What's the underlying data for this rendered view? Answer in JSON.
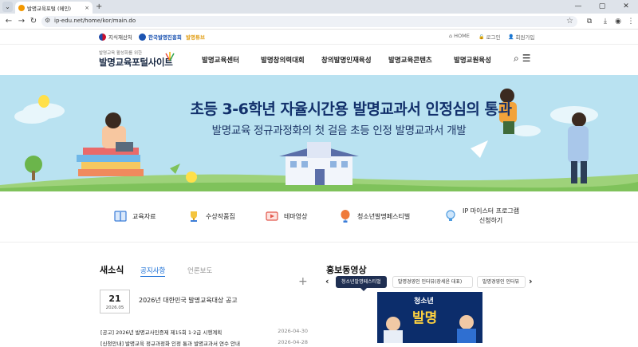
{
  "browser": {
    "tab_title": "발명교육포털 (메인)",
    "tab_close": "×",
    "new_tab": "+",
    "url": "ip-edu.net/home/kor/main.do",
    "window": {
      "minimize": "—",
      "maximize": "▢",
      "close": "✕"
    }
  },
  "topstrip": {
    "logos": [
      {
        "label": "지식재산처",
        "color": "#1f4aa8"
      },
      {
        "label": "한국발명진흥회",
        "color": "#1c54b2"
      },
      {
        "label": "발명튜브",
        "color": "#e2a01a"
      }
    ],
    "util": [
      {
        "icon": "home-icon",
        "glyph": "⌂",
        "label": "HOME"
      },
      {
        "icon": "lock-icon",
        "glyph": "🔒",
        "label": "로그인"
      },
      {
        "icon": "user-icon",
        "glyph": "👤",
        "label": "회원가입"
      }
    ]
  },
  "header": {
    "logo_tag": "발명교육 활성화를 위한",
    "logo_name": "발명교육포털사이트",
    "menu": [
      "발명교육센터",
      "발명창의력대회",
      "창의발명인재육성",
      "발명교육콘텐츠",
      "발명교원육성"
    ],
    "search_glyph": "⌕",
    "menu_glyph": "☰"
  },
  "banner": {
    "title": "초등 3-6학년 자율시간용 발명교과서 인정심의 통과",
    "subtitle": "발명교육 정규과정화의 첫 걸음 초등 인정 발명교과서 개발"
  },
  "quick_menu": [
    {
      "label": "교육자료",
      "icon": "book-icon",
      "color": "#3b7dd8"
    },
    {
      "label": "수상작품집",
      "icon": "trophy-icon",
      "color": "#e0a21c"
    },
    {
      "label": "테마영상",
      "icon": "video-icon",
      "color": "#e2574c"
    },
    {
      "label": "청소년발명페스티벌",
      "icon": "balloon-icon",
      "color": "#ef7a3b"
    },
    {
      "label_1": "IP 마이스터 프로그램",
      "label_2": "신청하기",
      "icon": "lightbulb-icon",
      "color": "#4c9be0"
    }
  ],
  "news": {
    "title": "새소식",
    "tabs": [
      "공지사항",
      "언론보도"
    ],
    "more": "+",
    "featured": {
      "day": "21",
      "month": "2026.05",
      "title": "2026년 대한민국 발명교육대상 공고"
    },
    "rows": [
      {
        "title": "[공고] 2026년 발명교사인증제 제15회 1·2급 시행계획",
        "date": "2026-04-30"
      },
      {
        "title": "[신청안내] 발명교육 정규과정화 인정 통과 발명교과서 연수 안내",
        "date": "2026-04-28"
      }
    ]
  },
  "promo": {
    "title": "홍보동영상",
    "prev": "‹",
    "next": "›",
    "tabs": [
      "청소년발명페스티벌",
      "발명경영인 인터뷰(장세윤 대표)",
      "발명경영인 인터뷰"
    ],
    "thumb_caption_1": "청소년",
    "thumb_caption_2": "발명"
  }
}
